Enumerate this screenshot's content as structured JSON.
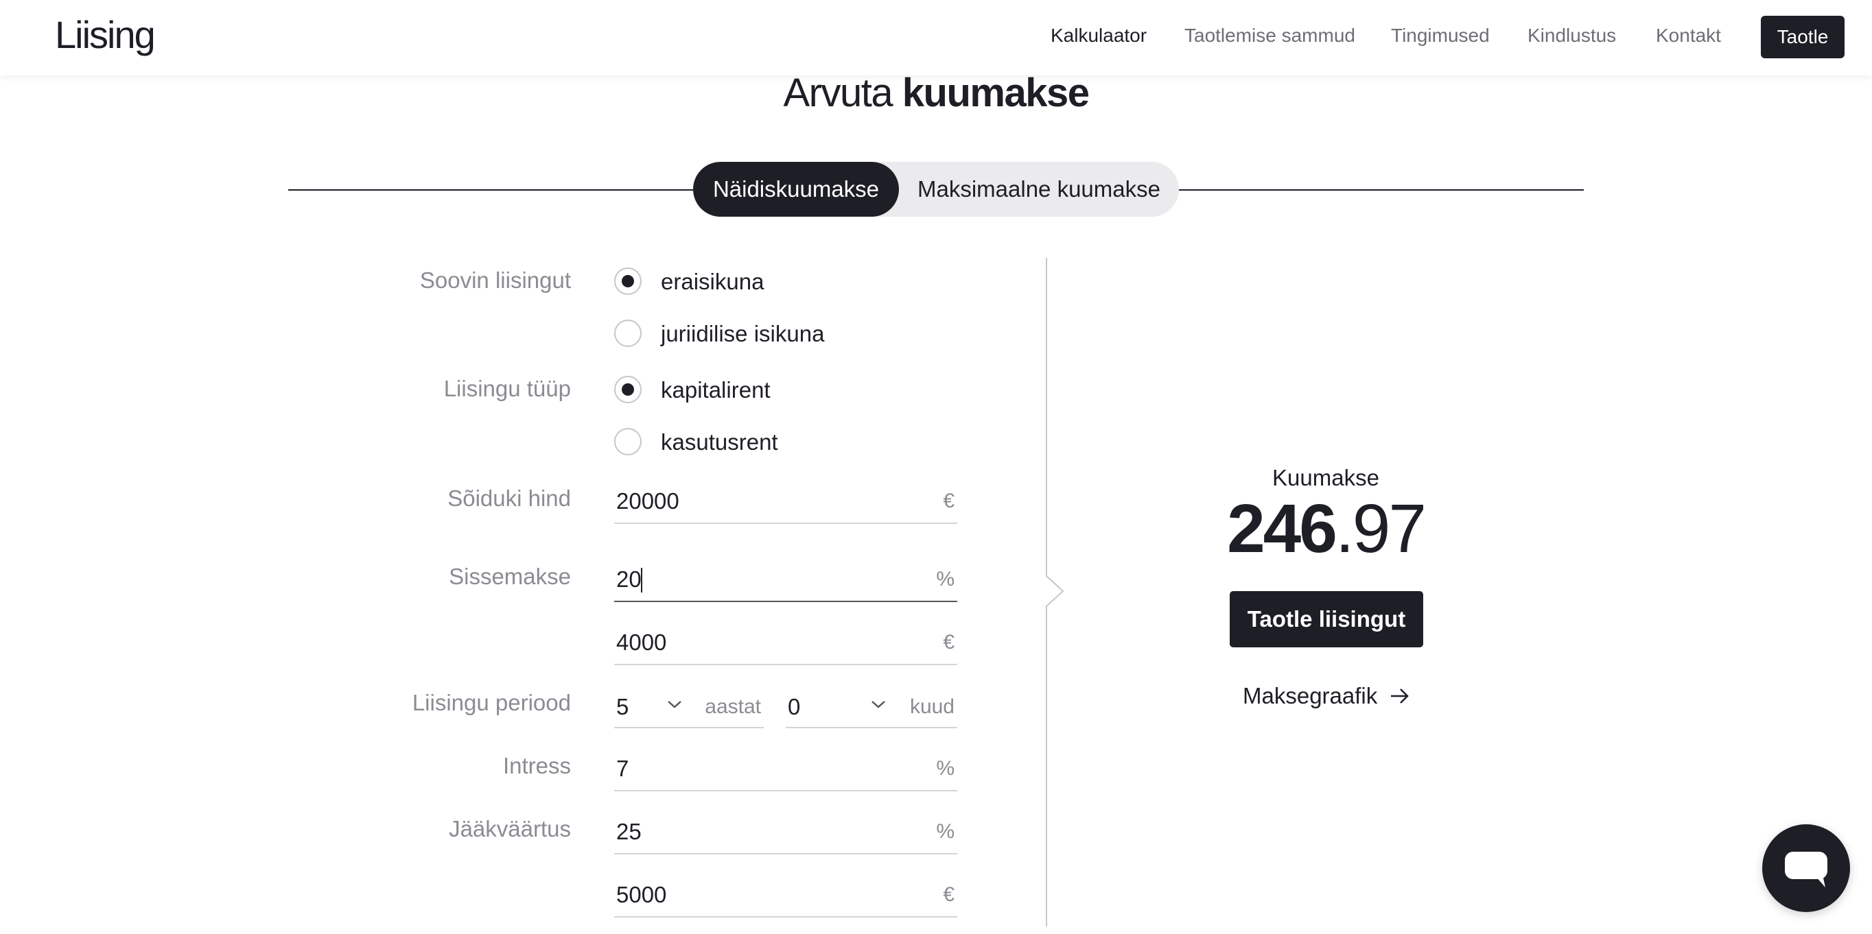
{
  "header": {
    "logo": "Liising",
    "nav": [
      {
        "label": "Kalkulaator",
        "active": true
      },
      {
        "label": "Taotlemise sammud",
        "active": false
      },
      {
        "label": "Tingimused",
        "active": false
      },
      {
        "label": "Kindlustus",
        "active": false
      },
      {
        "label": "Kontakt",
        "active": false
      }
    ],
    "apply_label": "Taotle"
  },
  "title": {
    "prefix": "Arvuta",
    "emphasis": "kuumakse"
  },
  "tabs": [
    {
      "label": "Näidiskuumakse",
      "active": true
    },
    {
      "label": "Maksimaalne kuumakse",
      "active": false
    }
  ],
  "form": {
    "applicant": {
      "label": "Soovin liisingut",
      "options": [
        {
          "label": "eraisikuna",
          "checked": true
        },
        {
          "label": "juriidilise isikuna",
          "checked": false
        }
      ]
    },
    "lease_type": {
      "label": "Liisingu tüüp",
      "options": [
        {
          "label": "kapitalirent",
          "checked": true
        },
        {
          "label": "kasutusrent",
          "checked": false
        }
      ]
    },
    "vehicle_price": {
      "label": "Sõiduki hind",
      "value": "20000",
      "unit": "€"
    },
    "down_payment": {
      "label": "Sissemakse",
      "percent": "20",
      "percent_unit": "%",
      "amount": "4000",
      "amount_unit": "€"
    },
    "period": {
      "label": "Liisingu periood",
      "years": "5",
      "years_unit": "aastat",
      "months": "0",
      "months_unit": "kuud"
    },
    "interest": {
      "label": "Intress",
      "value": "7",
      "unit": "%"
    },
    "residual": {
      "label": "Jääkväärtus",
      "percent": "25",
      "percent_unit": "%",
      "amount": "5000",
      "amount_unit": "€"
    }
  },
  "result": {
    "label": "Kuumakse",
    "integer": "246",
    "decimal": ".97",
    "cta_label": "Taotle liisingut",
    "schedule_label": "Maksegraafik"
  },
  "colors": {
    "primary": "#1e1f26",
    "muted": "#8b8c92",
    "tab_bg": "#ebebed",
    "line": "#d3d4d8"
  },
  "icons": {
    "chat": "chat-bubble-icon",
    "arrow": "arrow-right-icon",
    "chevron": "chevron-down-icon"
  }
}
